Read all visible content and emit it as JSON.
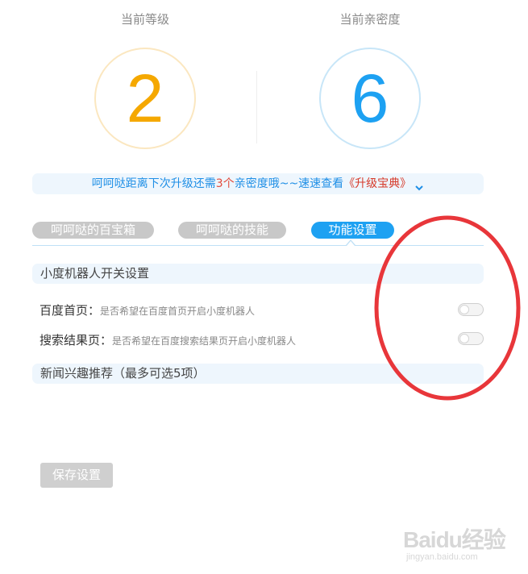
{
  "stats": {
    "level": {
      "label": "当前等级",
      "value": "2",
      "color": "#f5a800",
      "ring": "#fbe7c0"
    },
    "intimacy": {
      "label": "当前亲密度",
      "value": "6",
      "color": "#1da1f2",
      "ring": "#c8e6f8"
    }
  },
  "notice": {
    "prefix": "呵呵哒距离下次升级还需",
    "count": "3个",
    "middle": "亲密度哦~~速速查看",
    "book": "《升级宝典》",
    "icon": "chevron-down-icon"
  },
  "tabs": [
    {
      "label": "呵呵哒的百宝箱",
      "active": false
    },
    {
      "label": "呵呵哒的技能",
      "active": false
    },
    {
      "label": "功能设置",
      "active": true
    }
  ],
  "robot_section": {
    "title": "小度机器人开关设置",
    "rows": [
      {
        "label": "百度首页：",
        "desc": "是否希望在百度首页开启小度机器人",
        "enabled": false
      },
      {
        "label": "搜索结果页：",
        "desc": "是否希望在百度搜索结果页开启小度机器人",
        "enabled": false
      }
    ]
  },
  "news_section": {
    "title": "新闻兴趣推荐（最多可选5项）"
  },
  "save_button": {
    "label": "保存设置"
  },
  "annotation": {
    "color": "#e8363a"
  },
  "watermark": {
    "main": "Baidu经验",
    "sub": "jingyan.baidu.com"
  }
}
